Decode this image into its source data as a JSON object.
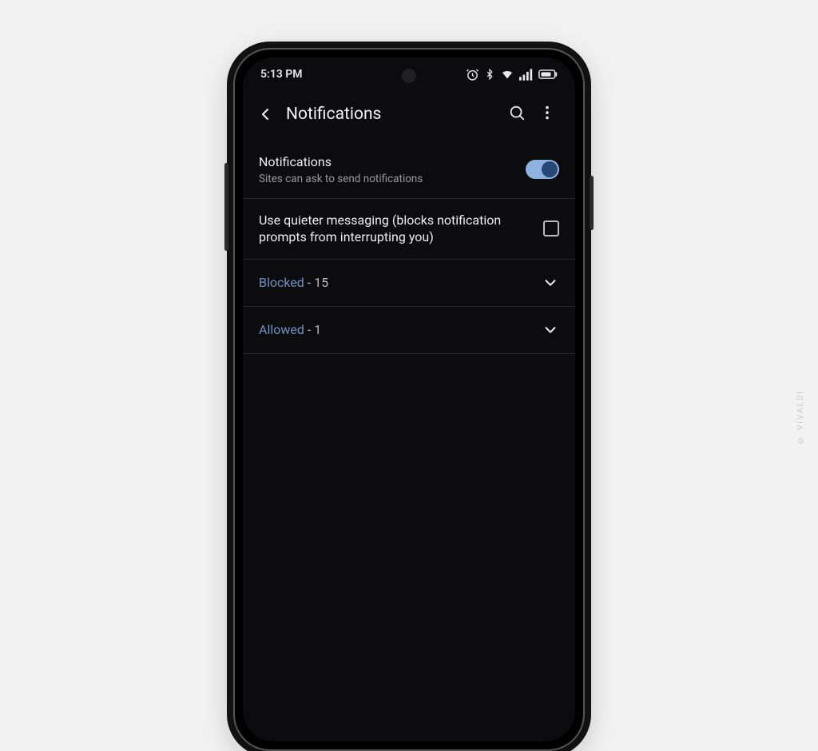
{
  "statusbar": {
    "time": "5:13 PM"
  },
  "appbar": {
    "title": "Notifications"
  },
  "rows": {
    "notifications": {
      "label": "Notifications",
      "sublabel": "Sites can ask to send notifications",
      "switch_on": true
    },
    "quieter": {
      "label": "Use quieter messaging (blocks notification prompts from interrupting you)",
      "checked": false
    },
    "blocked": {
      "label": "Blocked",
      "count_text": " - 15"
    },
    "allowed": {
      "label": "Allowed",
      "count_text": " - 1"
    }
  },
  "watermark": "© VIVALDI"
}
